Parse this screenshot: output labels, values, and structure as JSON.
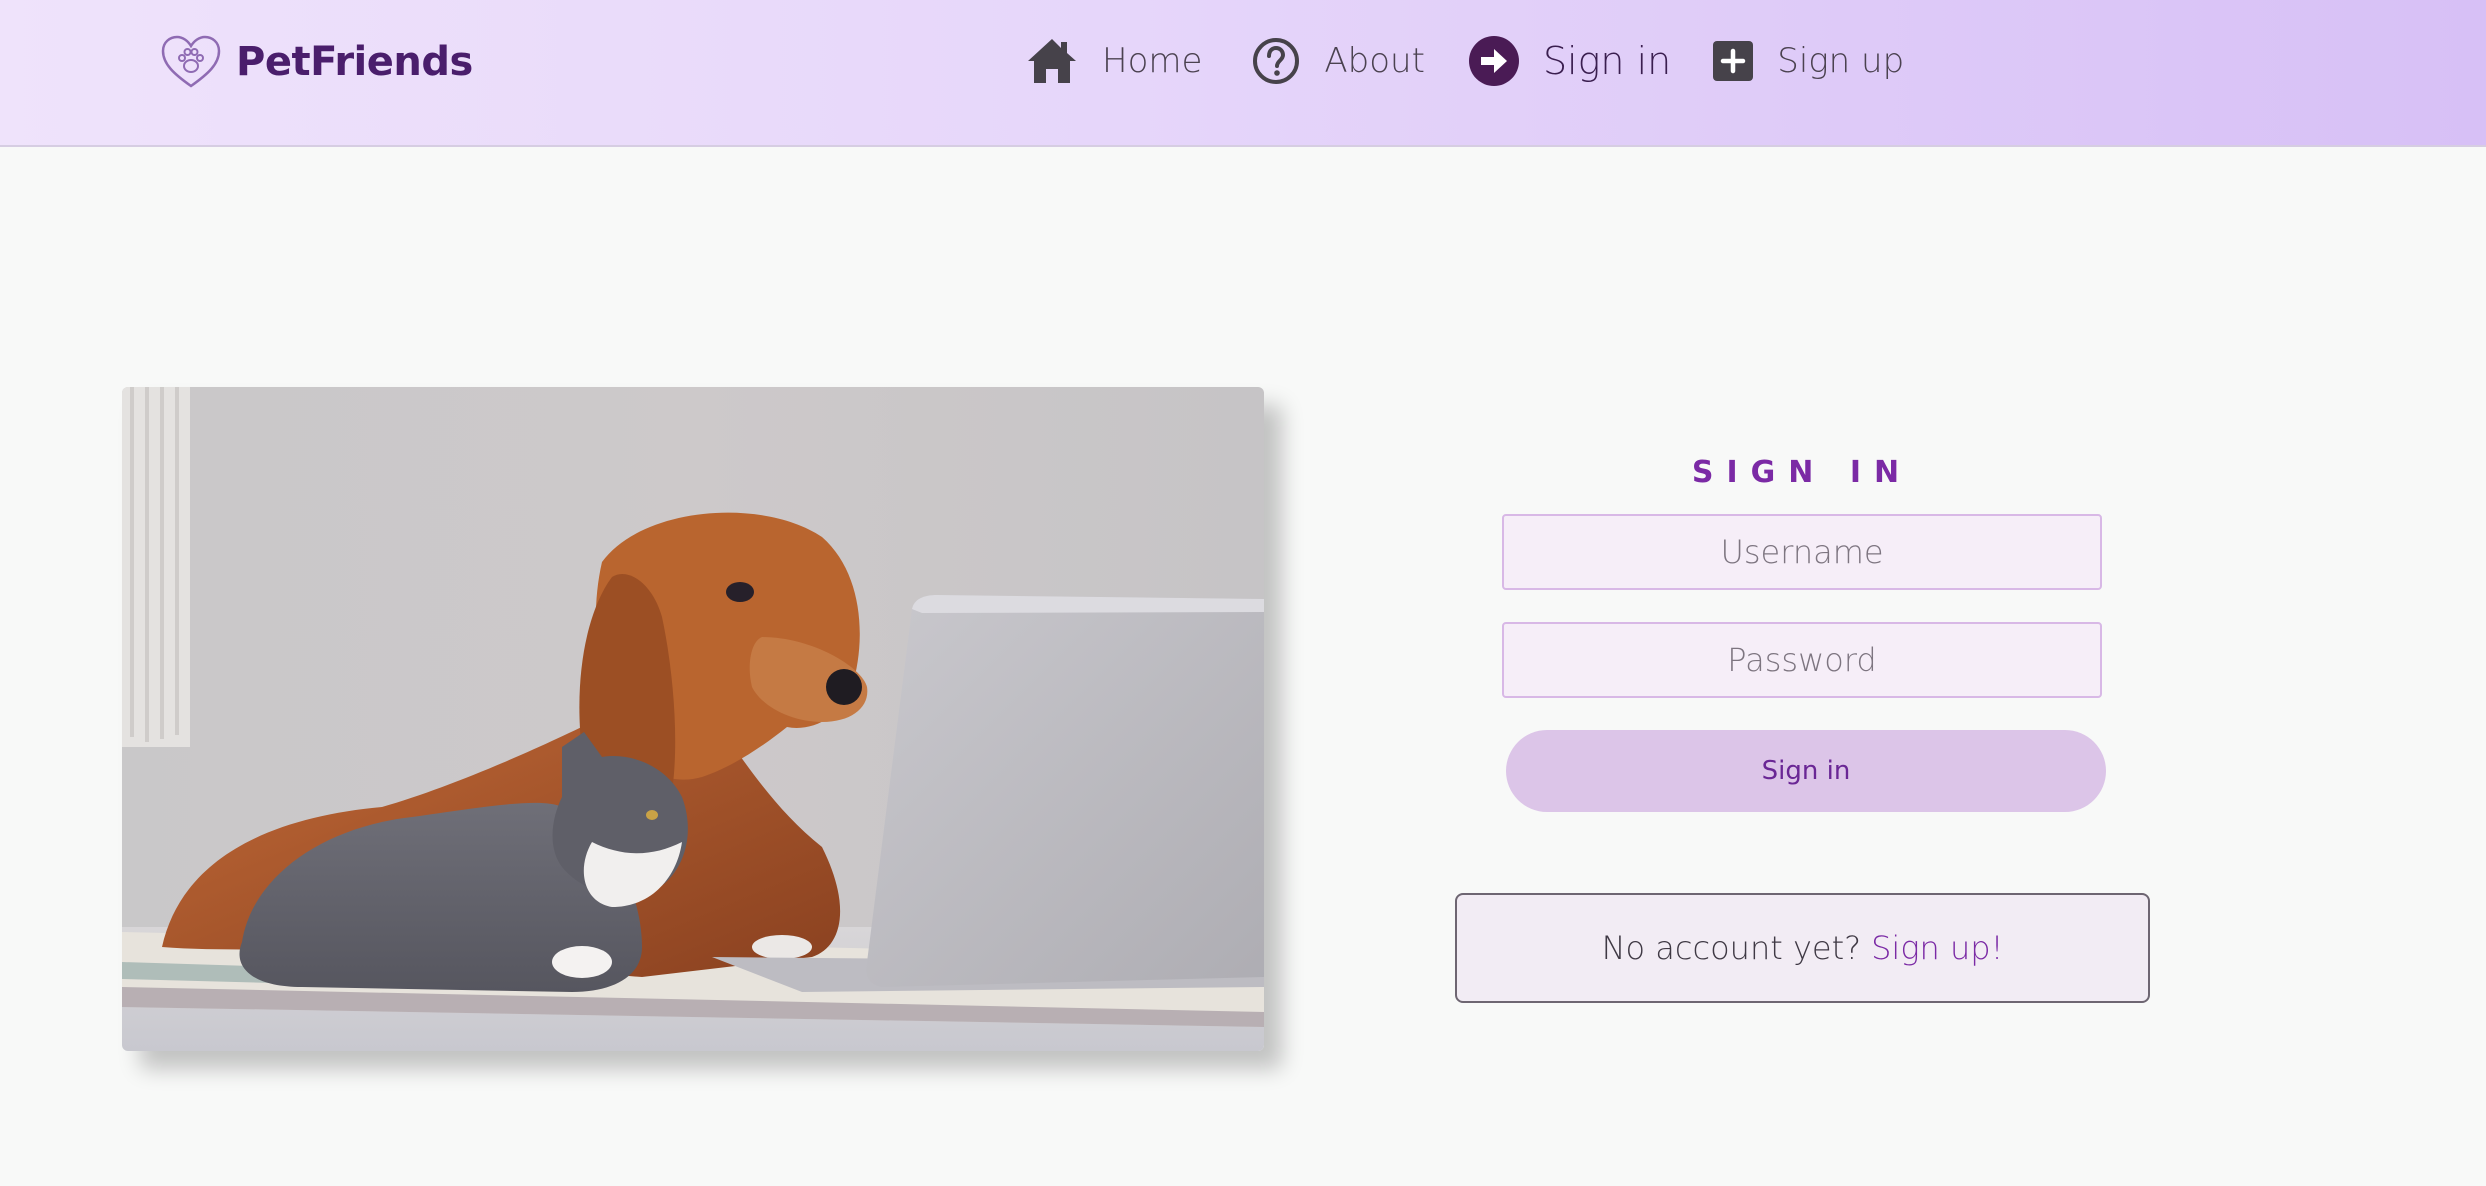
{
  "brand": {
    "name": "PetFriends",
    "logo_icon": "heart-paw-icon"
  },
  "nav": {
    "items": [
      {
        "label": "Home",
        "icon": "home-icon"
      },
      {
        "label": "About",
        "icon": "question-circle-icon"
      },
      {
        "label": "Sign in",
        "icon": "arrow-right-circle-icon",
        "active": true
      },
      {
        "label": "Sign up",
        "icon": "plus-square-icon"
      }
    ]
  },
  "hero": {
    "image": "dog-and-cat-with-laptop-photo"
  },
  "signin": {
    "title": "SIGN IN",
    "username_placeholder": "Username",
    "password_placeholder": "Password",
    "submit_label": "Sign in",
    "no_account_text": "No account yet?",
    "signup_link": "Sign up!"
  },
  "colors": {
    "brand": "#4a1e6c",
    "accent": "#7b2aa5",
    "button_bg": "#dcc5e8",
    "field_bg": "#f6eef8",
    "page_bg": "#f8f9f8"
  }
}
